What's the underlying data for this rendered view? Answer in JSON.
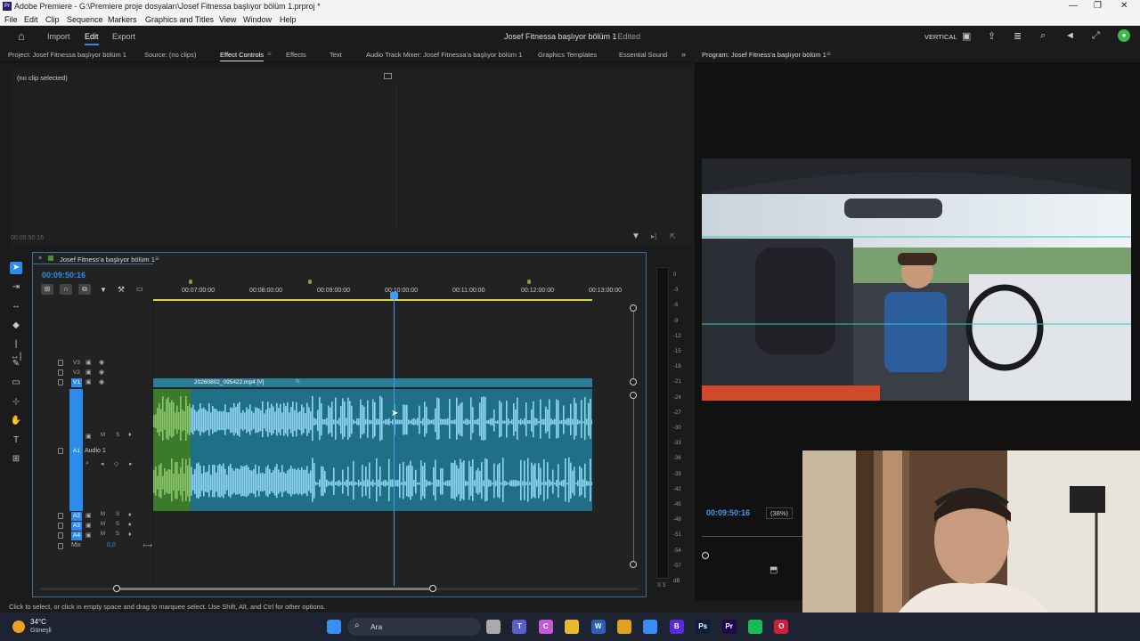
{
  "window": {
    "title": "Adobe Premiere - G:\\Premiere proje dosyaları\\Josef Fitnessa başlıyor bölüm 1.prproj *",
    "app_icon": "Pr"
  },
  "menu": [
    "File",
    "Edit",
    "Clip",
    "Sequence",
    "Markers",
    "Graphics and Titles",
    "View",
    "Window",
    "Help"
  ],
  "appbar": {
    "nav": [
      {
        "label": "Import"
      },
      {
        "label": "Edit"
      },
      {
        "label": "Export"
      }
    ],
    "project_title": "Josef Fitnessa başlıyor bölüm 1",
    "state": "- Edited",
    "layout_label": "VERTICAL"
  },
  "panel_tabs": [
    "Project: Josef Fitnessa başlıyor bölüm 1",
    "Source: (no clips)",
    "Effect Controls",
    "Effects",
    "Text",
    "Audio Track Mixer: Josef Fitnessa'a başlıyor bölüm 1",
    "Graphics Templates",
    "Essential Sound"
  ],
  "effect_controls": {
    "empty_text": "(no clip selected)",
    "timecode": "00:09:50:16"
  },
  "timeline": {
    "sequence_name": "Josef Fitness'a başlıyor bölüm 1",
    "timecode": "00:09:50:16",
    "ruler": [
      "00:07:00:00",
      "00:08:00:00",
      "00:09:00:00",
      "00:10:00:00",
      "00:11:00:00",
      "00:12:00:00",
      "00:13:00:00"
    ],
    "video_tracks": [
      "V3",
      "V2",
      "V1"
    ],
    "audio_tracks": [
      "A1",
      "A2",
      "A3",
      "A4"
    ],
    "audio_track_name": "Audio 1",
    "mix_label": "Mix",
    "mix_value": "0,0",
    "clip_name": "20260802_095422.mp4 [V]",
    "playhead_fraction": 0.547,
    "track_buttons": {
      "mute": "M",
      "solo": "S"
    }
  },
  "vu_scale": [
    "0",
    "-3",
    "-6",
    "-9",
    "-12",
    "-15",
    "-18",
    "-21",
    "-24",
    "-27",
    "-30",
    "-33",
    "-36",
    "-39",
    "-42",
    "-45",
    "-48",
    "-51",
    "-54",
    "-57",
    "dB"
  ],
  "vu_footer": "S  S",
  "program": {
    "title": "Program: Josef Fitness'a başlıyor bölüm 1",
    "timecode": "00:09:50:16",
    "zoom": "(38%)"
  },
  "status": "Click to select, or click in empty space and drag to marquee select. Use Shift, Alt, and Ctrl for other options.",
  "taskbar": {
    "temperature": "34°C",
    "weather": "Güneşli",
    "search": "Ara",
    "apps": [
      {
        "name": "windows-start",
        "glyph": "",
        "color": "#3a8df5"
      },
      {
        "name": "task-view",
        "glyph": "",
        "color": "#aaaaaa"
      },
      {
        "name": "teams",
        "glyph": "T",
        "color": "#5b5fc7"
      },
      {
        "name": "copilot",
        "glyph": "C",
        "color": "#c35bd6"
      },
      {
        "name": "file-explorer",
        "glyph": "",
        "color": "#e8b730"
      },
      {
        "name": "word",
        "glyph": "W",
        "color": "#2b5fb8"
      },
      {
        "name": "chrome",
        "glyph": "",
        "color": "#e0a020"
      },
      {
        "name": "store",
        "glyph": "",
        "color": "#3a8df5"
      },
      {
        "name": "app-b",
        "glyph": "B",
        "color": "#5a2ad8"
      },
      {
        "name": "photoshop",
        "glyph": "Ps",
        "color": "#0a1f3a"
      },
      {
        "name": "premiere",
        "glyph": "Pr",
        "color": "#1e0a4a"
      },
      {
        "name": "spotify",
        "glyph": "",
        "color": "#1db954"
      },
      {
        "name": "opera",
        "glyph": "O",
        "color": "#cc1f3a"
      }
    ]
  }
}
